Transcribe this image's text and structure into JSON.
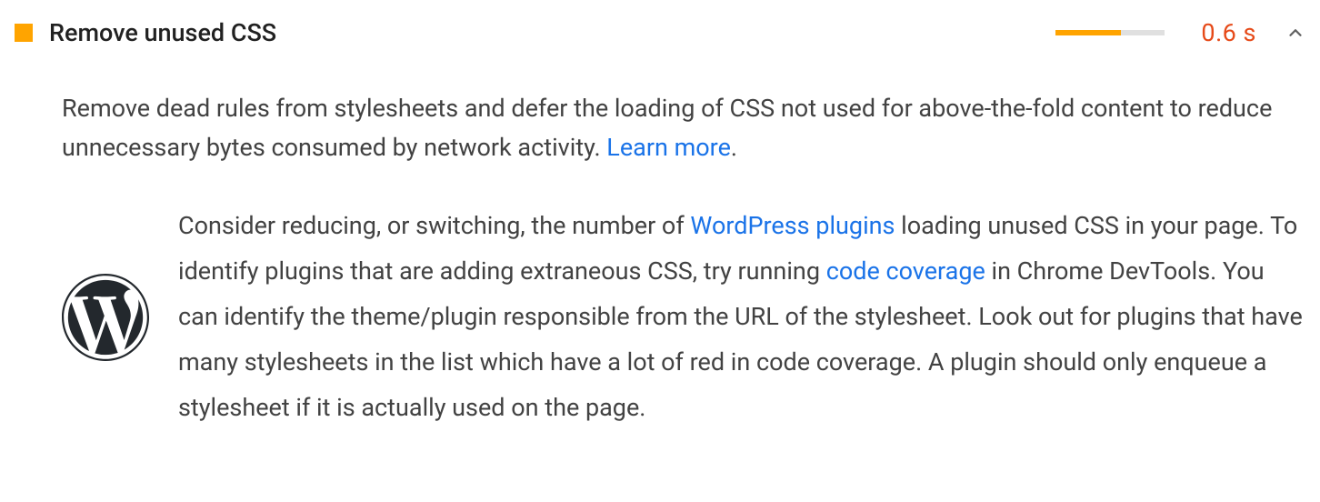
{
  "audit": {
    "title": "Remove unused CSS",
    "metric": "0.6 s",
    "sparkline_percent": 60,
    "description_pre": "Remove dead rules from stylesheets and defer the loading of CSS not used for above-the-fold content to reduce unnecessary bytes consumed by network activity. ",
    "learn_more": "Learn more",
    "description_post": ".",
    "stack": {
      "text_1": "Consider reducing, or switching, the number of ",
      "link_1": "WordPress plugins",
      "text_2": " loading unused CSS in your page. To identify plugins that are adding extraneous CSS, try running ",
      "link_2": "code coverage",
      "text_3": " in Chrome DevTools. You can identify the theme/plugin responsible from the URL of the stylesheet. Look out for plugins that have many stylesheets in the list which have a lot of red in code coverage. A plugin should only enqueue a stylesheet if it is actually used on the page."
    }
  }
}
